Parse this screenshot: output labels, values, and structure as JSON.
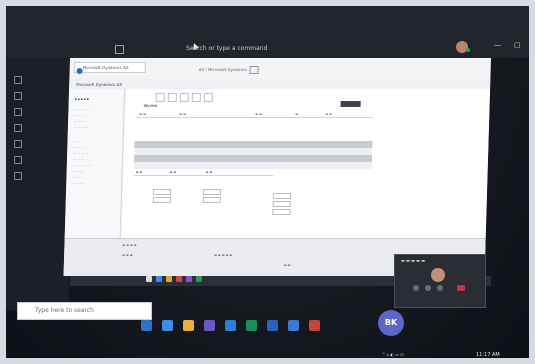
{
  "teams": {
    "search_label": "Search or type a command"
  },
  "browser": {
    "tab_title": "Microsoft Dynamics AX",
    "address": "AX | Microsoft Dynamics"
  },
  "app": {
    "title": "Microsoft Dynamics AX",
    "section_title": "Worker"
  },
  "taskbar": {
    "search_placeholder": "Type here to search"
  },
  "call": {
    "initials": "BK"
  },
  "clock": {
    "time": "11:17 AM"
  },
  "colors": {
    "accent": "#1670d4",
    "call_avatar": "#5b68c6",
    "end_call": "#c4314b"
  }
}
